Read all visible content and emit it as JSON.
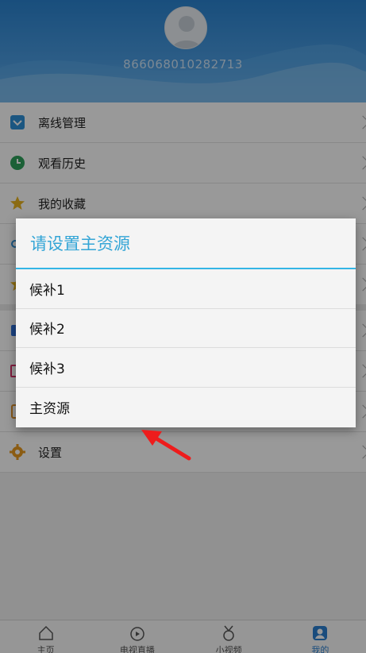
{
  "header": {
    "device_id": "866068010282713"
  },
  "menu": {
    "items": [
      {
        "label": "离线管理",
        "icon": "download-icon"
      },
      {
        "label": "观看历史",
        "icon": "clock-icon"
      },
      {
        "label": "我的收藏",
        "icon": "star-icon"
      },
      {
        "label": "",
        "icon": "link-icon"
      },
      {
        "label": "",
        "icon": "star-icon"
      },
      {
        "label": "",
        "icon": "tv-icon"
      },
      {
        "label": "",
        "icon": "message-icon"
      },
      {
        "label": "",
        "icon": "book-icon"
      },
      {
        "label": "设置",
        "icon": "gear-icon"
      }
    ]
  },
  "dialog": {
    "title": "请设置主资源",
    "options": [
      "候补1",
      "候补2",
      "候补3",
      "主资源"
    ]
  },
  "bottom_nav": {
    "items": [
      {
        "label": "主页",
        "icon": "home-icon"
      },
      {
        "label": "电视直播",
        "icon": "live-tv-icon"
      },
      {
        "label": "小视频",
        "icon": "short-video-icon"
      },
      {
        "label": "我的",
        "icon": "profile-icon",
        "active": true
      }
    ]
  },
  "colors": {
    "header": "#2a83d0",
    "dialog_accent": "#33b5e5",
    "annotation_arrow": "#ee1c1c",
    "nav_active": "#2a7fd0"
  }
}
